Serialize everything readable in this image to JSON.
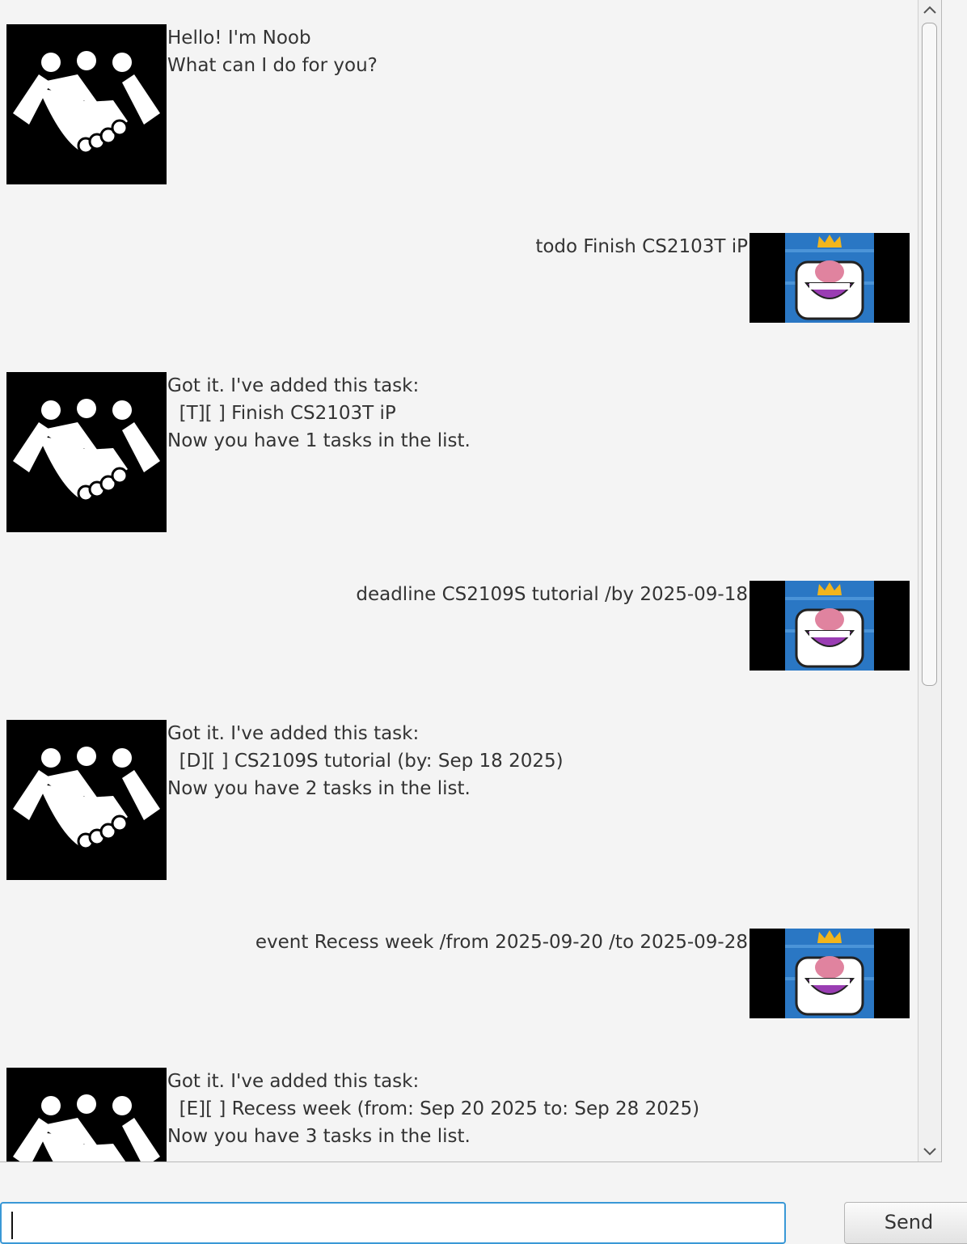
{
  "dialogs": [
    {
      "speaker": "duke",
      "lines": "Hello! I'm Noob\nWhat can I do for you?"
    },
    {
      "speaker": "user",
      "lines": "todo Finish CS2103T iP"
    },
    {
      "speaker": "duke",
      "lines": "Got it. I've added this task:\n  [T][ ] Finish CS2103T iP\nNow you have 1 tasks in the list."
    },
    {
      "speaker": "user",
      "lines": "deadline CS2109S tutorial /by 2025-09-18"
    },
    {
      "speaker": "duke",
      "lines": "Got it. I've added this task:\n  [D][ ] CS2109S tutorial (by: Sep 18 2025)\nNow you have 2 tasks in the list."
    },
    {
      "speaker": "user",
      "lines": "event Recess week /from 2025-09-20 /to 2025-09-28"
    },
    {
      "speaker": "duke",
      "lines": "Got it. I've added this task:\n  [E][ ] Recess week (from: Sep 20 2025 to: Sep 28 2025)\nNow you have 3 tasks in the list."
    }
  ],
  "icons": {
    "duke_avatar": "handshake-icon",
    "user_avatar": "king-emote-icon",
    "scroll_up": "chevron-up-icon",
    "scroll_down": "chevron-down-icon"
  },
  "input": {
    "value": "",
    "placeholder": ""
  },
  "send_button": {
    "label": "Send"
  },
  "colors": {
    "input_focus": "#3a98d6",
    "user_avatar_bg": "#2a77c4",
    "duke_avatar_bg": "#000000"
  }
}
